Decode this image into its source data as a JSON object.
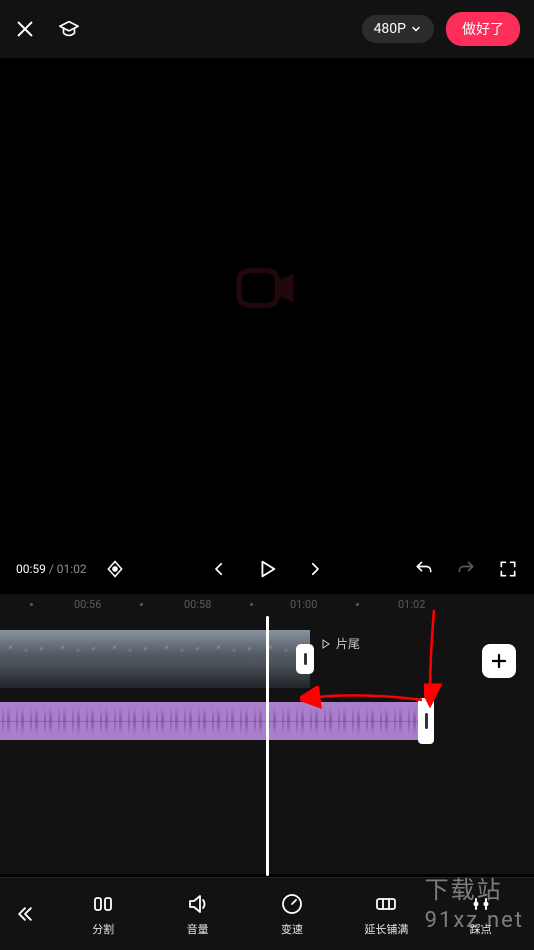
{
  "header": {
    "resolution_label": "480P",
    "done_label": "做好了"
  },
  "playback": {
    "current_time": "00:59",
    "separator": " / ",
    "total_time": "01:02"
  },
  "ruler": {
    "ticks": [
      "00:56",
      "00:58",
      "01:00",
      "01:02"
    ]
  },
  "tracks": {
    "outro_label": "片尾"
  },
  "tools": {
    "split": "分割",
    "volume": "音量",
    "speed": "变速",
    "extend": "延长铺满",
    "bridge": "踩点"
  },
  "watermark": {
    "line1": "下载站",
    "line2": "91xz.net"
  }
}
